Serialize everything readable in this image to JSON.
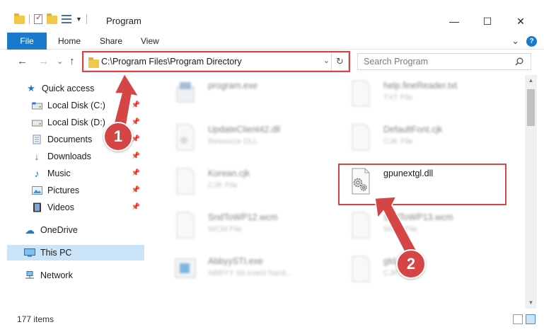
{
  "window": {
    "title": "Program",
    "minimize": "—",
    "maximize": "☐",
    "close": "✕"
  },
  "ribbon": {
    "tabs": [
      "File",
      "Home",
      "Share",
      "View"
    ],
    "expand": "⌄",
    "help": "?"
  },
  "nav": {
    "back": "←",
    "forward": "→",
    "recent": "⌄",
    "up": "↑",
    "address": "C:\\Program Files\\Program Directory",
    "dropdown": "⌄",
    "refresh": "↻",
    "search_placeholder": "Search Program"
  },
  "sidebar": {
    "items": [
      {
        "label": "Quick access",
        "icon": "star-icon",
        "pinned": false
      },
      {
        "label": "Local Disk (C:)",
        "icon": "drive-icon",
        "pinned": true
      },
      {
        "label": "Local Disk (D:)",
        "icon": "drive-icon",
        "pinned": true
      },
      {
        "label": "Documents",
        "icon": "documents-icon",
        "pinned": true
      },
      {
        "label": "Downloads",
        "icon": "download-icon",
        "pinned": true
      },
      {
        "label": "Music",
        "icon": "music-icon",
        "pinned": true
      },
      {
        "label": "Pictures",
        "icon": "pictures-icon",
        "pinned": true
      },
      {
        "label": "Videos",
        "icon": "videos-icon",
        "pinned": true
      },
      {
        "label": "OneDrive",
        "icon": "cloud-icon",
        "pinned": false
      },
      {
        "label": "This PC",
        "icon": "computer-icon",
        "pinned": false,
        "selected": true
      },
      {
        "label": "Network",
        "icon": "network-icon",
        "pinned": false
      }
    ],
    "pin_glyph": "📌"
  },
  "files": [
    {
      "name": "program.exe",
      "type": "",
      "blurred": true
    },
    {
      "name": "help.fineReader.txt",
      "type": "TXT File",
      "blurred": true
    },
    {
      "name": "UpdateClient42.dll",
      "type": "Resource DLL",
      "blurred": true
    },
    {
      "name": "DefaultFont.cjk",
      "type": "CJK File",
      "blurred": true
    },
    {
      "name": "Korean.cjk",
      "type": "CJK File",
      "blurred": true
    },
    {
      "name": "gpunextgl.dll",
      "type": "",
      "blurred": false
    },
    {
      "name": "SndToWP12.wcm",
      "type": "WCM File",
      "blurred": true
    },
    {
      "name": "SndToWP13.wcm",
      "type": "WCM File",
      "blurred": true
    },
    {
      "name": "AbbyySTI.exe",
      "type": "ABBYY Sti event hand...",
      "blurred": true
    },
    {
      "name": "gtd.cjk",
      "type": "CJK File",
      "blurred": true
    }
  ],
  "status": {
    "count": "177 items"
  },
  "callouts": {
    "first": "1",
    "second": "2"
  },
  "colors": {
    "accent": "#1979ca",
    "highlight": "#d64545",
    "selected": "#cce4f7"
  }
}
